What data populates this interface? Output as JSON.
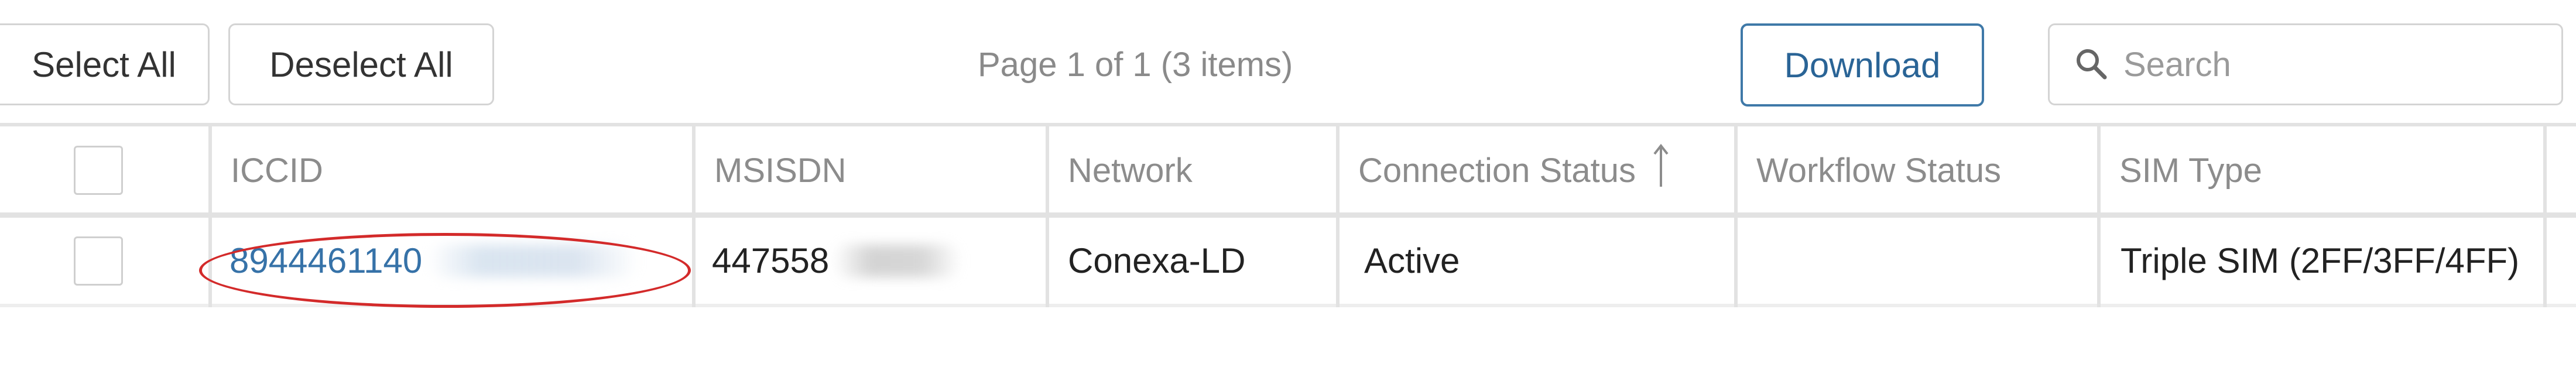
{
  "toolbar": {
    "select_all_label": "Select All",
    "deselect_all_label": "Deselect All",
    "pager_text": "Page 1 of 1 (3 items)",
    "download_label": "Download",
    "search": {
      "placeholder": "Search",
      "value": ""
    }
  },
  "table": {
    "columns": [
      {
        "key": "select",
        "label": ""
      },
      {
        "key": "iccid",
        "label": "ICCID"
      },
      {
        "key": "msisdn",
        "label": "MSISDN"
      },
      {
        "key": "network",
        "label": "Network"
      },
      {
        "key": "connection_status",
        "label": "Connection Status",
        "sort": "ascending"
      },
      {
        "key": "workflow_status",
        "label": "Workflow Status"
      },
      {
        "key": "sim_type",
        "label": "SIM Type"
      }
    ],
    "rows": [
      {
        "selected": false,
        "iccid": "8944461140",
        "iccid_redacted": true,
        "msisdn": "447558",
        "msisdn_redacted": true,
        "network": "Conexa-LD",
        "connection_status": "Active",
        "workflow_status": "",
        "sim_type": "Triple SIM (2FF/3FF/4FF)"
      }
    ]
  },
  "annotation": {
    "shape": "ellipse",
    "color": "#d32a2a",
    "highlights": "iccid"
  },
  "colors": {
    "link": "#3672a8",
    "download_border": "#3f79a8",
    "grid_line": "#e2e2e2",
    "header_text": "#8c8c8c"
  }
}
